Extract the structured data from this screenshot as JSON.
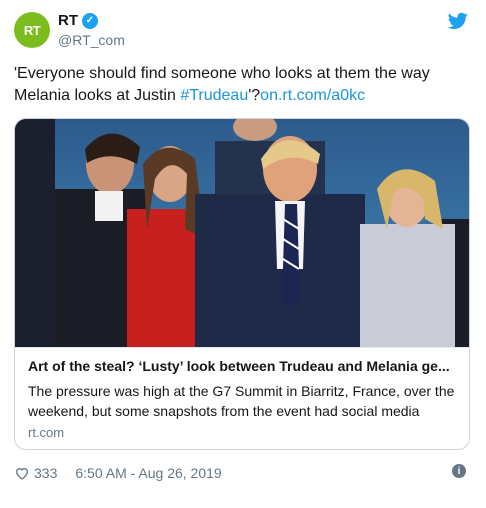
{
  "account": {
    "avatar_text": "RT",
    "display_name": "RT",
    "handle": "@RT_com",
    "avatar_color": "#7cbd1e",
    "verified_color": "#1da1f2"
  },
  "tweet": {
    "text_before": "'Everyone should find someone who looks at them the way Melania looks at Justin ",
    "hashtag": "#Trudeau",
    "text_after": "'?",
    "link": "on.rt.com/a0kc"
  },
  "card": {
    "title": "Art of the steal? ‘Lusty’ look between Trudeau and Melania ge...",
    "description": "The pressure was high at the G7 Summit in Biarritz, France, over the weekend, but some snapshots from the event had social media",
    "domain": "rt.com"
  },
  "footer": {
    "likes": "333",
    "timestamp": "6:50 AM - Aug 26, 2019"
  },
  "colors": {
    "link": "#1b95e0",
    "muted": "#657786",
    "border": "#ccd6dd"
  }
}
